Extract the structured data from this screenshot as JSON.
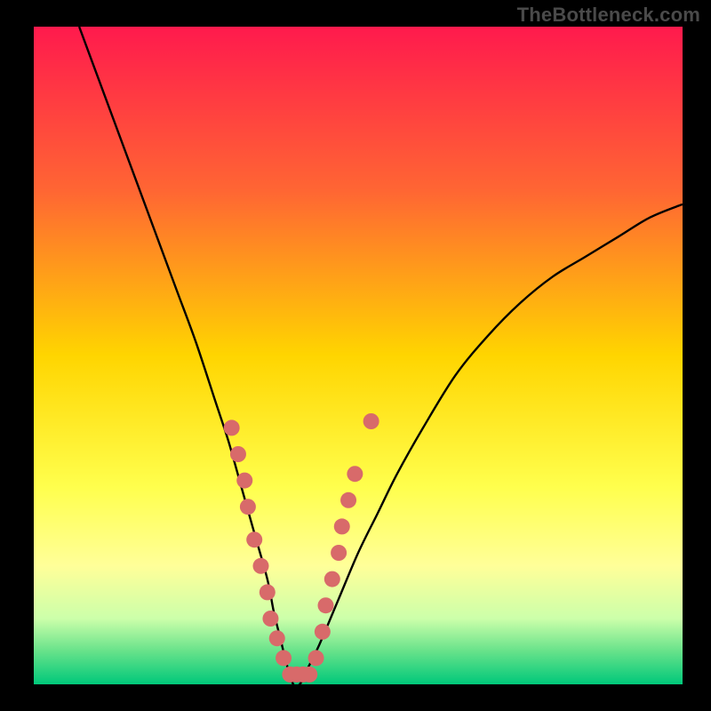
{
  "watermark": "TheBottleneck.com",
  "chart_data": {
    "type": "line",
    "title": "",
    "xlabel": "",
    "ylabel": "",
    "xlim": [
      0,
      100
    ],
    "ylim": [
      0,
      100
    ],
    "background_gradient": {
      "stops": [
        {
          "offset": 0,
          "color": "#ff1a4d"
        },
        {
          "offset": 25,
          "color": "#ff6633"
        },
        {
          "offset": 50,
          "color": "#ffd500"
        },
        {
          "offset": 70,
          "color": "#ffff4d"
        },
        {
          "offset": 82,
          "color": "#ffff99"
        },
        {
          "offset": 90,
          "color": "#ccffaa"
        },
        {
          "offset": 95,
          "color": "#66e28a"
        },
        {
          "offset": 100,
          "color": "#00c87a"
        }
      ]
    },
    "series": [
      {
        "name": "bottleneck-curve",
        "color": "#000000",
        "x": [
          7,
          10,
          13,
          16,
          19,
          22,
          25,
          28,
          30,
          32,
          34,
          36,
          37,
          38,
          39,
          40,
          41,
          42,
          44,
          47,
          50,
          53,
          56,
          60,
          65,
          70,
          75,
          80,
          85,
          90,
          95,
          100
        ],
        "y": [
          100,
          92,
          84,
          76,
          68,
          60,
          52,
          43,
          37,
          30,
          23,
          16,
          11,
          7,
          3,
          0,
          0,
          2,
          6,
          13,
          20,
          26,
          32,
          39,
          47,
          53,
          58,
          62,
          65,
          68,
          71,
          73
        ]
      }
    ],
    "scatter": {
      "name": "data-points",
      "color": "#d86a6a",
      "radius": 9,
      "points": [
        {
          "x": 30.5,
          "y": 39
        },
        {
          "x": 31.5,
          "y": 35
        },
        {
          "x": 32.5,
          "y": 31
        },
        {
          "x": 33.0,
          "y": 27
        },
        {
          "x": 34.0,
          "y": 22
        },
        {
          "x": 35.0,
          "y": 18
        },
        {
          "x": 36.0,
          "y": 14
        },
        {
          "x": 36.5,
          "y": 10
        },
        {
          "x": 37.5,
          "y": 7
        },
        {
          "x": 38.5,
          "y": 4
        },
        {
          "x": 39.5,
          "y": 1.5
        },
        {
          "x": 40.5,
          "y": 1.5
        },
        {
          "x": 41.5,
          "y": 1.5
        },
        {
          "x": 42.5,
          "y": 1.5
        },
        {
          "x": 43.5,
          "y": 4
        },
        {
          "x": 44.5,
          "y": 8
        },
        {
          "x": 45.0,
          "y": 12
        },
        {
          "x": 46.0,
          "y": 16
        },
        {
          "x": 47.0,
          "y": 20
        },
        {
          "x": 47.5,
          "y": 24
        },
        {
          "x": 48.5,
          "y": 28
        },
        {
          "x": 49.5,
          "y": 32
        },
        {
          "x": 52.0,
          "y": 40
        }
      ]
    }
  }
}
